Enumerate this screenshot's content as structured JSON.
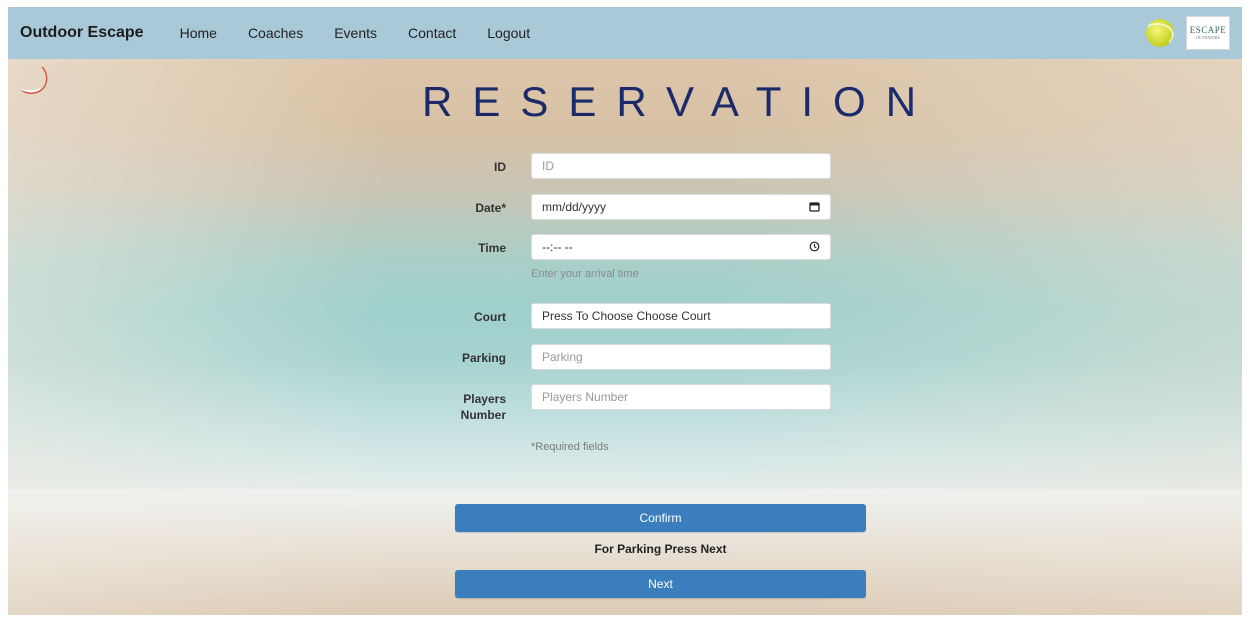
{
  "navbar": {
    "brand": "Outdoor Escape",
    "links": [
      "Home",
      "Coaches",
      "Events",
      "Contact",
      "Logout"
    ],
    "logo_text_main": "ESCAPE",
    "logo_text_sub": "OUTDATORS"
  },
  "page": {
    "title": "RESERVATION"
  },
  "form": {
    "id": {
      "label": "ID",
      "placeholder": "ID"
    },
    "date": {
      "label": "Date*",
      "placeholder": "mm/dd/yyyy",
      "icon": "calendar-icon"
    },
    "time": {
      "label": "Time",
      "placeholder": "--:-- --",
      "helper": "Enter your arrival time",
      "icon": "clock-icon"
    },
    "court": {
      "label": "Court",
      "value": "Press To Choose Choose Court"
    },
    "parking": {
      "label": "Parking",
      "placeholder": "Parking"
    },
    "players": {
      "label_line1": "Players",
      "label_line2": "Number",
      "placeholder": "Players Number"
    },
    "required_note": "*Required fields"
  },
  "actions": {
    "confirm": "Confirm",
    "parking_note": "For Parking Press Next",
    "next": "Next"
  },
  "colors": {
    "navbar": "#a9c9d9",
    "title": "#1b2a6a",
    "button": "#3a7ebd"
  }
}
